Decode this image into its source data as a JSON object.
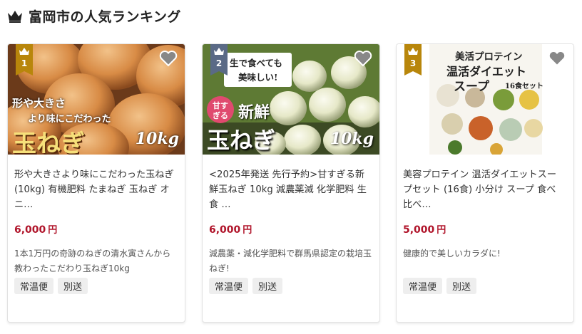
{
  "header": {
    "title": "富岡市の人気ランキング",
    "icon": "crown-icon"
  },
  "colors": {
    "accent_price": "#b0142a",
    "rank_gold": "#b8860b",
    "rank_slate": "#5a6a86",
    "tag_bg": "#eeeeee"
  },
  "cards": [
    {
      "rank": "1",
      "image_text": {
        "line1": "形や大きさ",
        "line2": "より味にこだわった",
        "big": "玉ねぎ",
        "weight": "10kg"
      },
      "title": "形や大きさより味にこだわった玉ねぎ (10kg) 有機肥料 たまねぎ 玉ねぎ オニ…",
      "price": "6,000",
      "yen": "円",
      "description": "1本1万円の奇跡のねぎの清水寅さんから教わったこだわり玉ねぎ10kg",
      "tags": [
        "常温便",
        "別送"
      ]
    },
    {
      "rank": "2",
      "image_text": {
        "banner1": "生で食べても",
        "banner2": "美味しい!",
        "badge1": "甘す",
        "badge2": "ぎる",
        "fresh": "新鮮",
        "big": "玉ねぎ",
        "weight": "10kg"
      },
      "title": "<2025年発送 先行予約>甘すぎる新鮮玉ねぎ 10kg 減農薬減 化学肥料 生食 …",
      "price": "6,000",
      "yen": "円",
      "description": "減農薬・減化学肥料で群馬県認定の栽培玉ねぎ!",
      "tags": [
        "常温便",
        "別送"
      ]
    },
    {
      "rank": "3",
      "image_text": {
        "line1": "美活プロテイン",
        "line2": "温活ダイエット",
        "line3": "スープ",
        "set": "16食セット"
      },
      "title": "美容プロテイン 温活ダイエットスープセット (16食) 小分け スープ 食べ比べ…",
      "price": "5,000",
      "yen": "円",
      "description": "健康的で美しいカラダに!",
      "tags": [
        "常温便",
        "別送"
      ]
    }
  ]
}
